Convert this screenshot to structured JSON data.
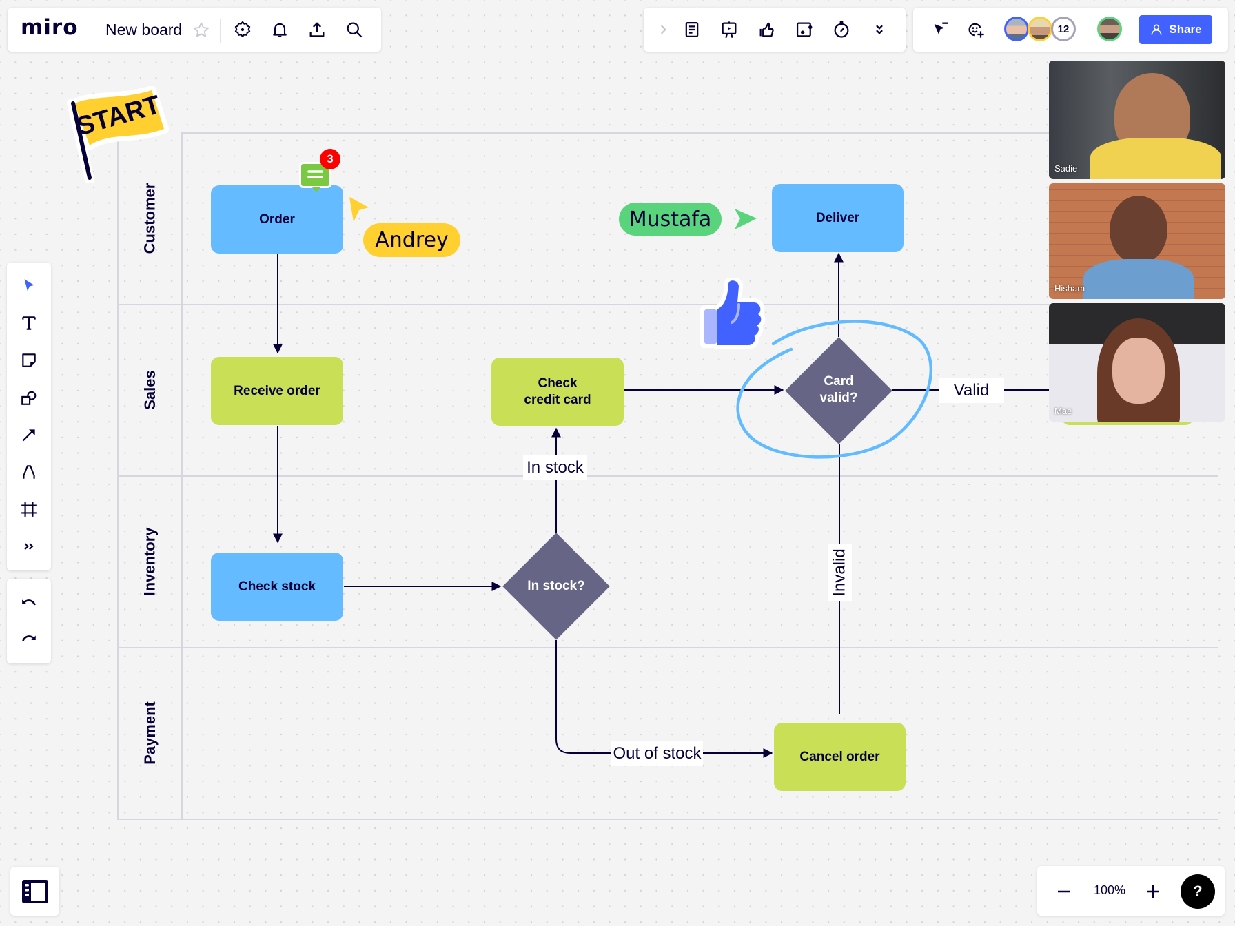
{
  "app": {
    "logo": "miro",
    "board_name": "New board"
  },
  "top_left_toolbar": {
    "icons": [
      "star-icon",
      "gear-icon",
      "bell-icon",
      "upload-icon",
      "search-icon"
    ]
  },
  "collab_toolbar": {
    "icons": [
      "chevron-right-icon",
      "notes-icon",
      "presentation-icon",
      "thumbs-up-icon",
      "card-icon",
      "timer-icon",
      "more-icon"
    ]
  },
  "people_toolbar": {
    "icons": [
      "cursor-filter-icon",
      "reaction-add-icon"
    ],
    "extra_participants_count": "12",
    "share_label": "Share"
  },
  "colors": {
    "accent": "#4262ff",
    "blue_shape": "#65bbff",
    "green_shape": "#c9df56",
    "decision": "#666586",
    "ink": "#050038",
    "cursor_andrey": "#ffd02f",
    "cursor_mustafa": "#59d47c",
    "highlight_circle": "#62bbff"
  },
  "sticker": {
    "text": "START"
  },
  "swimlanes": [
    {
      "label": "Customer"
    },
    {
      "label": "Sales"
    },
    {
      "label": "Inventory"
    },
    {
      "label": "Payment"
    }
  ],
  "nodes": {
    "order": "Order",
    "deliver": "Deliver",
    "receive_order": "Receive order",
    "check_credit_card_1": "Check",
    "check_credit_card_2": "credit card",
    "card_valid_1": "Card",
    "card_valid_2": "valid?",
    "check_stock": "Check stock",
    "in_stock_q": "In stock?",
    "cancel_order": "Cancel order"
  },
  "edge_labels": {
    "in_stock": "In stock",
    "valid": "Valid",
    "invalid": "Invalid",
    "out_of_stock": "Out of stock"
  },
  "comment": {
    "count": "3"
  },
  "cursors": [
    {
      "name": "Andrey"
    },
    {
      "name": "Mustafa"
    }
  ],
  "video_participants": [
    {
      "name": "Sadie"
    },
    {
      "name": "Hisham"
    },
    {
      "name": "Mae"
    }
  ],
  "left_toolbar": {
    "tools": [
      "select-icon",
      "text-icon",
      "sticky-note-icon",
      "shapes-icon",
      "connector-icon",
      "pen-icon",
      "frame-icon",
      "more-tools-icon"
    ],
    "history": [
      "undo-icon",
      "redo-icon"
    ]
  },
  "zoom": {
    "level": "100%",
    "help": "?"
  }
}
